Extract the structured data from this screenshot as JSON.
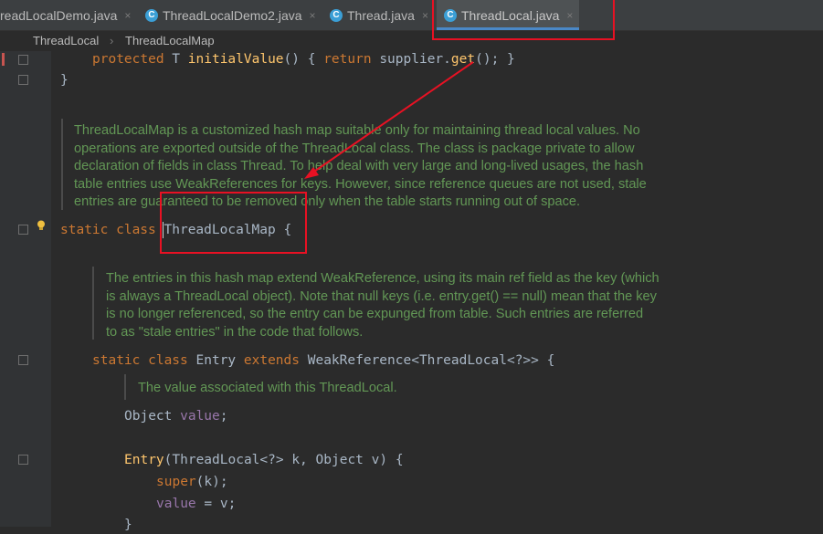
{
  "tabs": [
    {
      "label": "readLocalDemo.java",
      "icon": "none"
    },
    {
      "label": "ThreadLocalDemo2.java",
      "icon": "class-icon"
    },
    {
      "label": "Thread.java",
      "icon": "class-icon"
    },
    {
      "label": "ThreadLocal.java",
      "icon": "class-icon",
      "active": true
    }
  ],
  "class_icon_letter": "C",
  "close_glyph": "×",
  "breadcrumb": [
    "ThreadLocal",
    "ThreadLocalMap"
  ],
  "breadcrumb_sep": "›",
  "code": {
    "line1": {
      "kw": "protected",
      "type": " T ",
      "fn": "initialValue",
      "paren": "() { ",
      "kw2": "return",
      "rest1": " supplier.",
      "fn2": "get",
      "rest2": "(); }"
    },
    "line2": "}",
    "class_line": {
      "kw": "static class ",
      "name": "ThreadLocalMap",
      "rest": " {"
    },
    "entry_line": {
      "kw": "static class ",
      "name": "Entry ",
      "kw2": "extends",
      "rest": " WeakReference<ThreadLocal<?>> {"
    },
    "object_line": {
      "type": "Object ",
      "fld": "value",
      "rest": ";"
    },
    "ctor_line": {
      "fn": "Entry",
      "rest": "(ThreadLocal<?> k, Object v) {"
    },
    "super_line": {
      "kw": "super",
      "rest": "(k);"
    },
    "assign_line": {
      "fld": "value",
      "rest": " = v;"
    },
    "close_line": "}"
  },
  "docs": {
    "map_doc": [
      "ThreadLocalMap is a customized hash map suitable only for maintaining thread local values. No",
      "operations are exported outside of the ThreadLocal class. The class is package private to allow",
      "declaration of fields in class Thread. To help deal with very large and long-lived usages, the hash",
      "table entries use WeakReferences for keys. However, since reference queues are not used, stale",
      "entries are guaranteed to be removed only when the table starts running out of space."
    ],
    "entry_doc": [
      "The entries in this hash map extend WeakReference, using its main ref field as the key (which",
      "is always a ThreadLocal object). Note that null keys (i.e. entry.get() == null) mean that the key",
      "is no longer referenced, so the entry can be expunged from table. Such entries are referred",
      "to as \"stale entries\" in the code that follows."
    ],
    "value_doc": "The value associated with this ThreadLocal."
  },
  "colors": {
    "annotation": "#e81123",
    "keyword": "#cc7832",
    "method": "#ffc66d",
    "field": "#9876aa",
    "doc": "#629755"
  }
}
